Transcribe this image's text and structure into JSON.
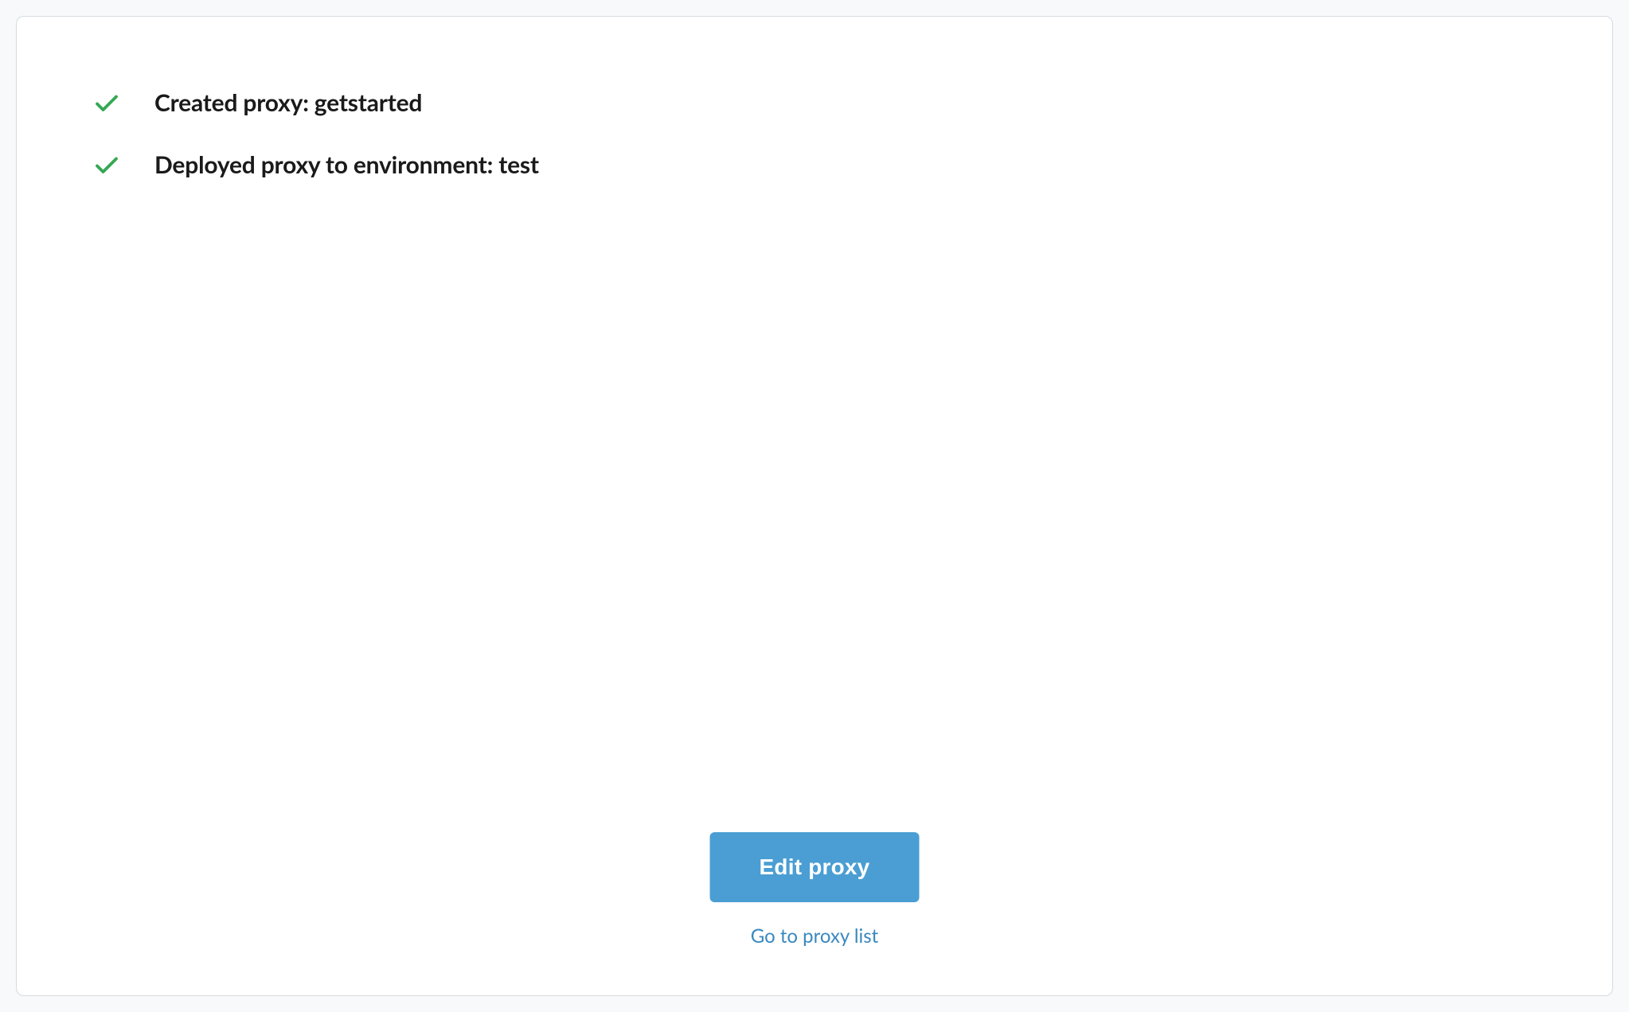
{
  "status": {
    "items": [
      {
        "label": "Created proxy: getstarted"
      },
      {
        "label": "Deployed proxy to environment: test"
      }
    ]
  },
  "actions": {
    "primary_button_label": "Edit proxy",
    "secondary_link_label": "Go to proxy list"
  }
}
